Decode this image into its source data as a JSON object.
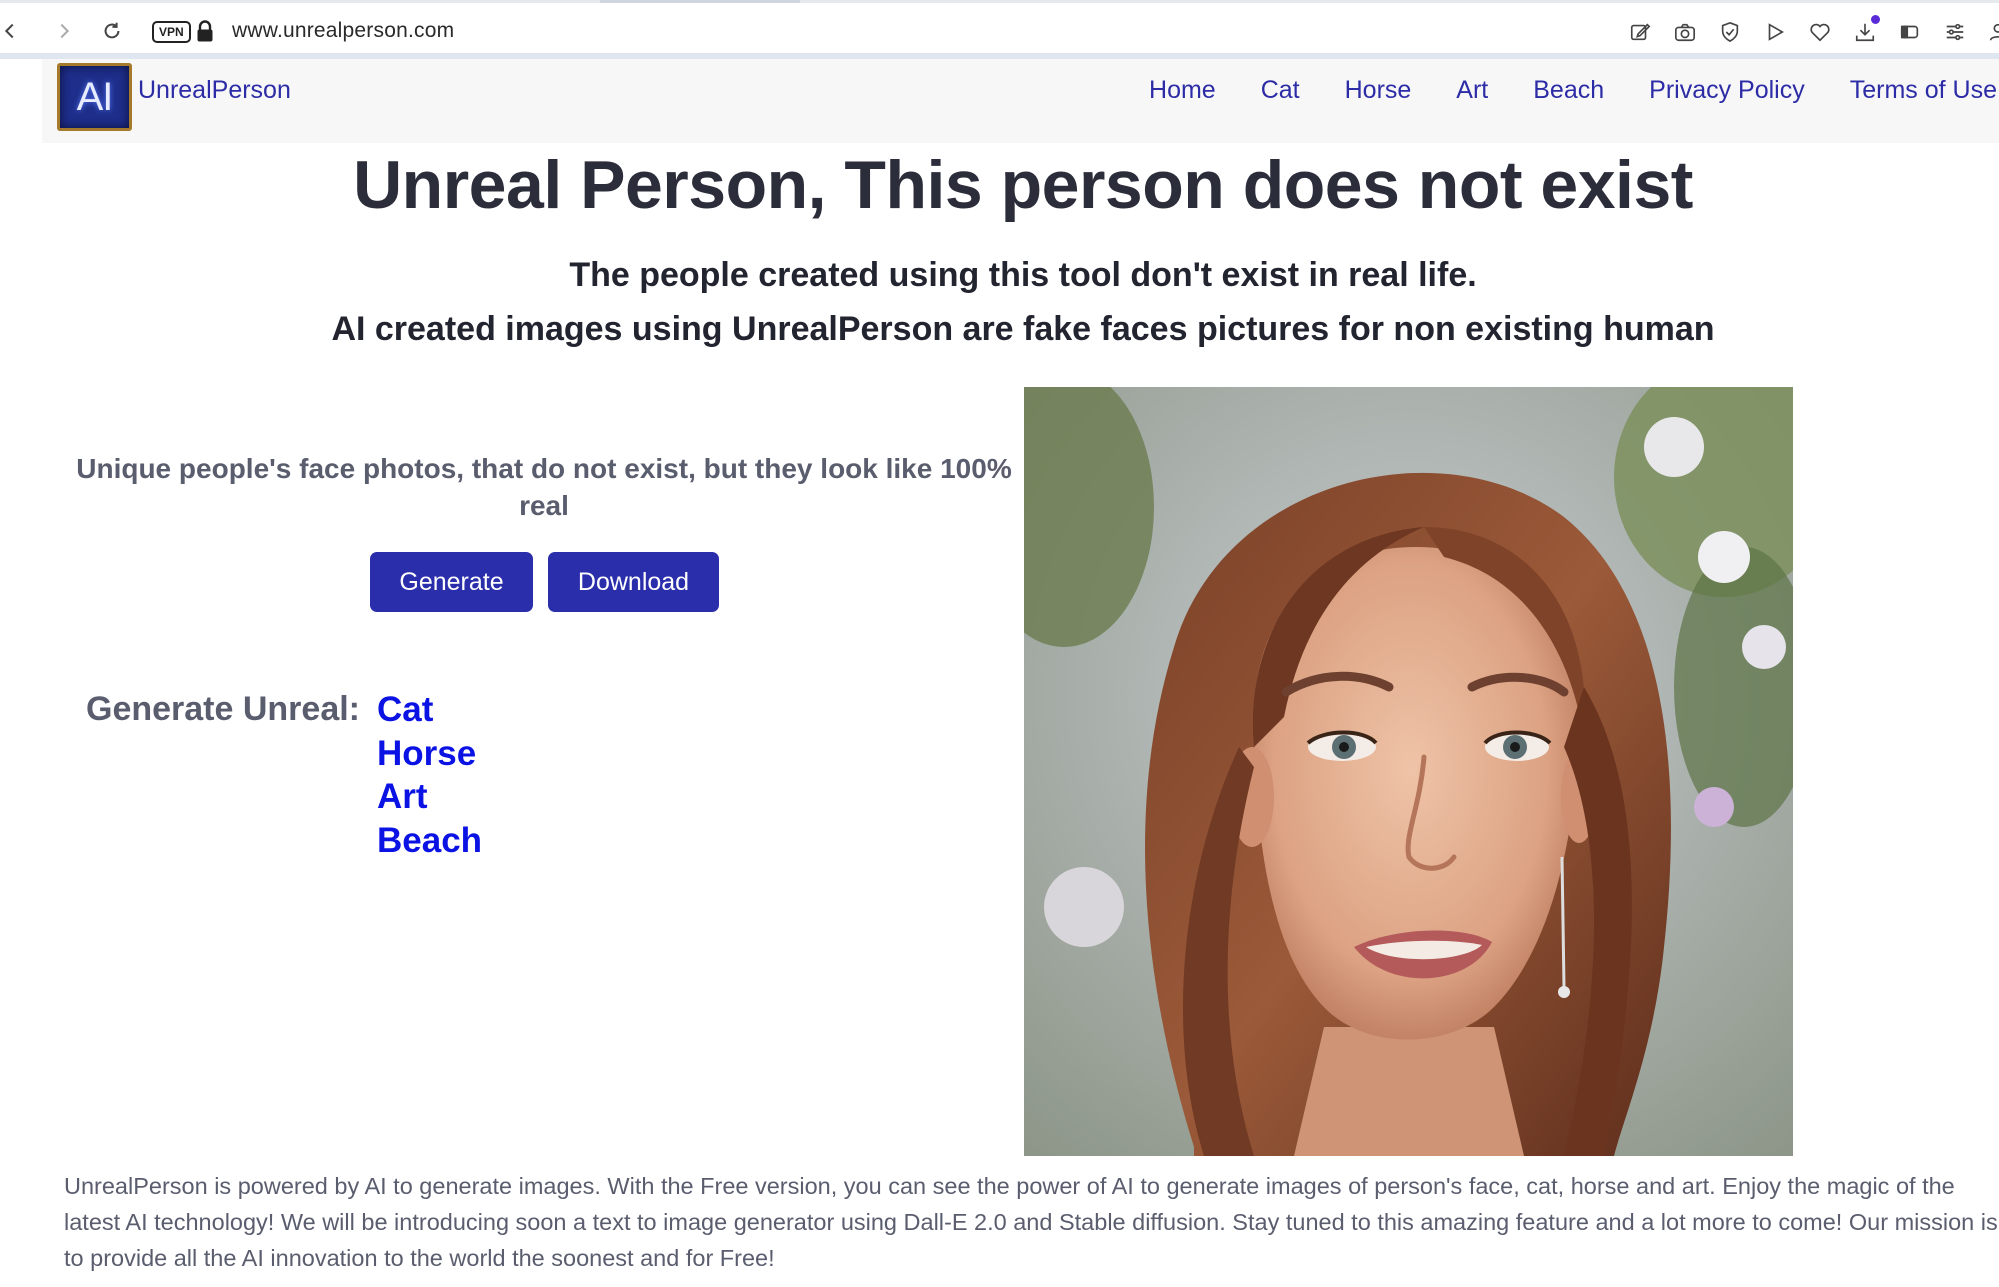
{
  "browser": {
    "url": "www.unrealperson.com",
    "vpn_label": "VPN"
  },
  "site": {
    "logo_text": "AI",
    "brand": "UnrealPerson",
    "nav": [
      "Home",
      "Cat",
      "Horse",
      "Art",
      "Beach",
      "Privacy Policy",
      "Terms of Use"
    ]
  },
  "main": {
    "title": "Unreal Person, This person does not exist",
    "subtitle_1": "The people created using this tool don't exist in real life.",
    "subtitle_2": "AI created images using UnrealPerson are fake faces pictures for non existing human",
    "tagline": "Unique people's face photos, that do not exist, but they look like 100% real",
    "generate_button": "Generate",
    "download_button": "Download",
    "generate_unreal_label": "Generate Unreal:",
    "generate_links": [
      "Cat",
      "Horse",
      "Art",
      "Beach"
    ],
    "footer": "UnrealPerson is powered by AI to generate images. With the Free version, you can see the power of AI to generate images of person's face, cat, horse and art. Enjoy the magic of the latest AI technology! We will be introducing soon a text to image generator using Dall-E 2.0 and Stable diffusion. Stay tuned to this amazing feature and a lot more to come! Our mission is to provide all the AI innovation to the world the soonest and for Free!"
  },
  "colors": {
    "accent": "#2b2eab",
    "link": "#0b12e4",
    "nav_link": "#2c2ca6"
  }
}
